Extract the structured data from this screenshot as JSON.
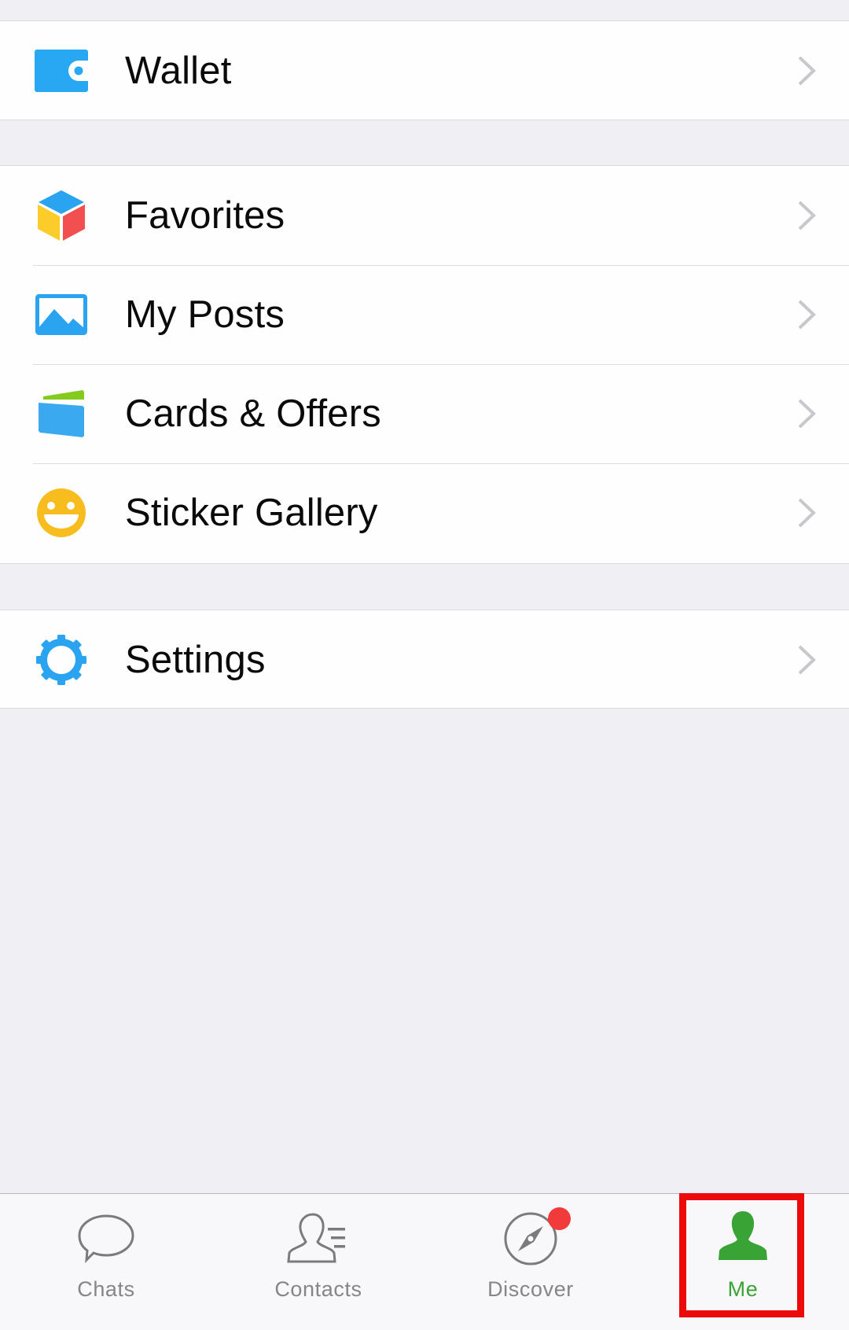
{
  "sections": [
    {
      "id": "wallet",
      "items": [
        {
          "label": "Wallet",
          "icon": "wallet-icon"
        }
      ]
    },
    {
      "id": "main",
      "items": [
        {
          "label": "Favorites",
          "icon": "favorites-cube-icon"
        },
        {
          "label": "My Posts",
          "icon": "photo-album-icon"
        },
        {
          "label": "Cards & Offers",
          "icon": "cards-icon"
        },
        {
          "label": "Sticker Gallery",
          "icon": "smiley-icon"
        }
      ]
    },
    {
      "id": "settings",
      "items": [
        {
          "label": "Settings",
          "icon": "gear-icon"
        }
      ]
    }
  ],
  "tabbar": {
    "tabs": [
      {
        "label": "Chats",
        "icon": "chat-bubble-icon",
        "active": false
      },
      {
        "label": "Contacts",
        "icon": "contacts-icon",
        "active": false
      },
      {
        "label": "Discover",
        "icon": "compass-icon",
        "active": false,
        "badge": "dot"
      },
      {
        "label": "Me",
        "icon": "person-icon",
        "active": true
      }
    ],
    "highlighted_tab": "Me"
  },
  "colors": {
    "background": "#efeff4",
    "accent_active": "#3aa336",
    "tab_inactive": "#85858a",
    "icon_blue": "#29a6f1",
    "badge_red": "#f23a3a",
    "highlight_box": "#ec0a0a",
    "chevron": "#c7c7cc"
  }
}
